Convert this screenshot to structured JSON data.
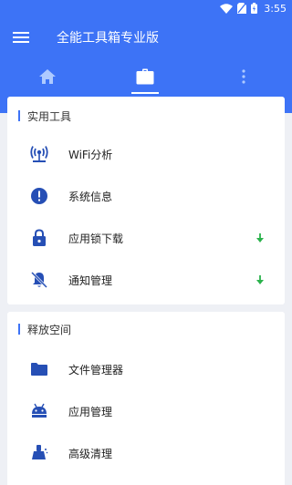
{
  "status": {
    "time": "3:55"
  },
  "header": {
    "title": "全能工具箱专业版"
  },
  "tabs": [
    {
      "name": "home",
      "icon": "home-icon"
    },
    {
      "name": "tools",
      "icon": "briefcase-icon",
      "selected": true
    },
    {
      "name": "more",
      "icon": "more-vert-icon"
    }
  ],
  "sections": [
    {
      "title": "实用工具",
      "items": [
        {
          "label": "WiFi分析",
          "icon": "wifi-antenna-icon"
        },
        {
          "label": "系统信息",
          "icon": "info-icon"
        },
        {
          "label": "应用锁下载",
          "icon": "lock-icon",
          "download": true
        },
        {
          "label": "通知管理",
          "icon": "notification-off-icon",
          "download": true
        }
      ]
    },
    {
      "title": "释放空间",
      "items": [
        {
          "label": "文件管理器",
          "icon": "folder-icon"
        },
        {
          "label": "应用管理",
          "icon": "android-icon"
        },
        {
          "label": "高级清理",
          "icon": "broom-icon"
        }
      ]
    }
  ],
  "colors": {
    "accent": "#3d73f6",
    "icon": "#264fb5",
    "download_arrow": "#2bb24c"
  }
}
